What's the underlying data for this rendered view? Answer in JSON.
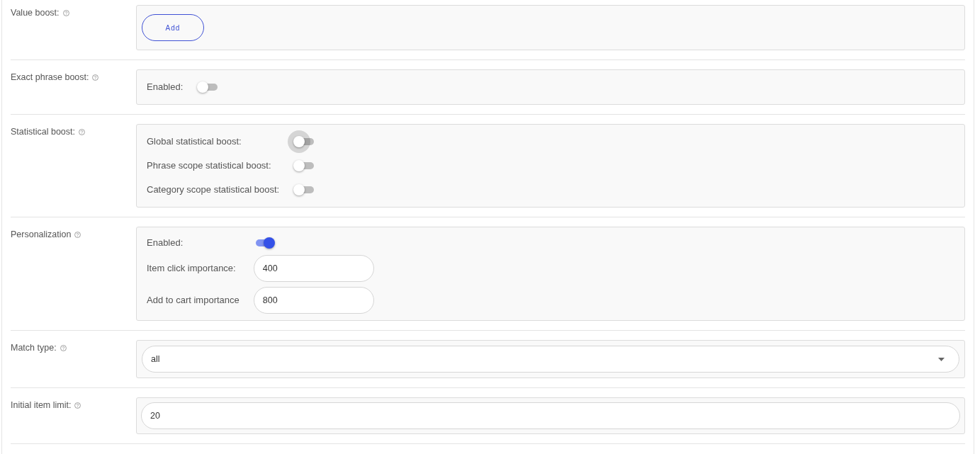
{
  "sections": [
    {
      "label": "Value boost:",
      "kind": "add",
      "button": "Add"
    },
    {
      "label": "Exact phrase boost:",
      "kind": "rows",
      "rows": [
        {
          "kind": "toggle",
          "label": "Enabled:",
          "on": false,
          "focused": false
        }
      ]
    },
    {
      "label": "Statistical boost:",
      "kind": "rows",
      "rows": [
        {
          "kind": "toggle",
          "label": "Global statistical boost:",
          "on": false,
          "focused": true
        },
        {
          "kind": "toggle",
          "label": "Phrase scope statistical boost:",
          "on": false,
          "focused": false
        },
        {
          "kind": "toggle",
          "label": "Category scope statistical boost:",
          "on": false,
          "focused": false
        }
      ]
    },
    {
      "label": "Personalization",
      "kind": "rows",
      "rows": [
        {
          "kind": "toggle",
          "label": "Enabled:",
          "on": true,
          "focused": false
        },
        {
          "kind": "field",
          "label": "Item click importance:",
          "value": "400"
        },
        {
          "kind": "field",
          "label": "Add to cart importance",
          "value": "800"
        }
      ]
    },
    {
      "label": "Match type:",
      "kind": "select",
      "value": "all"
    },
    {
      "label": "Initial item limit:",
      "kind": "input",
      "value": "20"
    }
  ]
}
